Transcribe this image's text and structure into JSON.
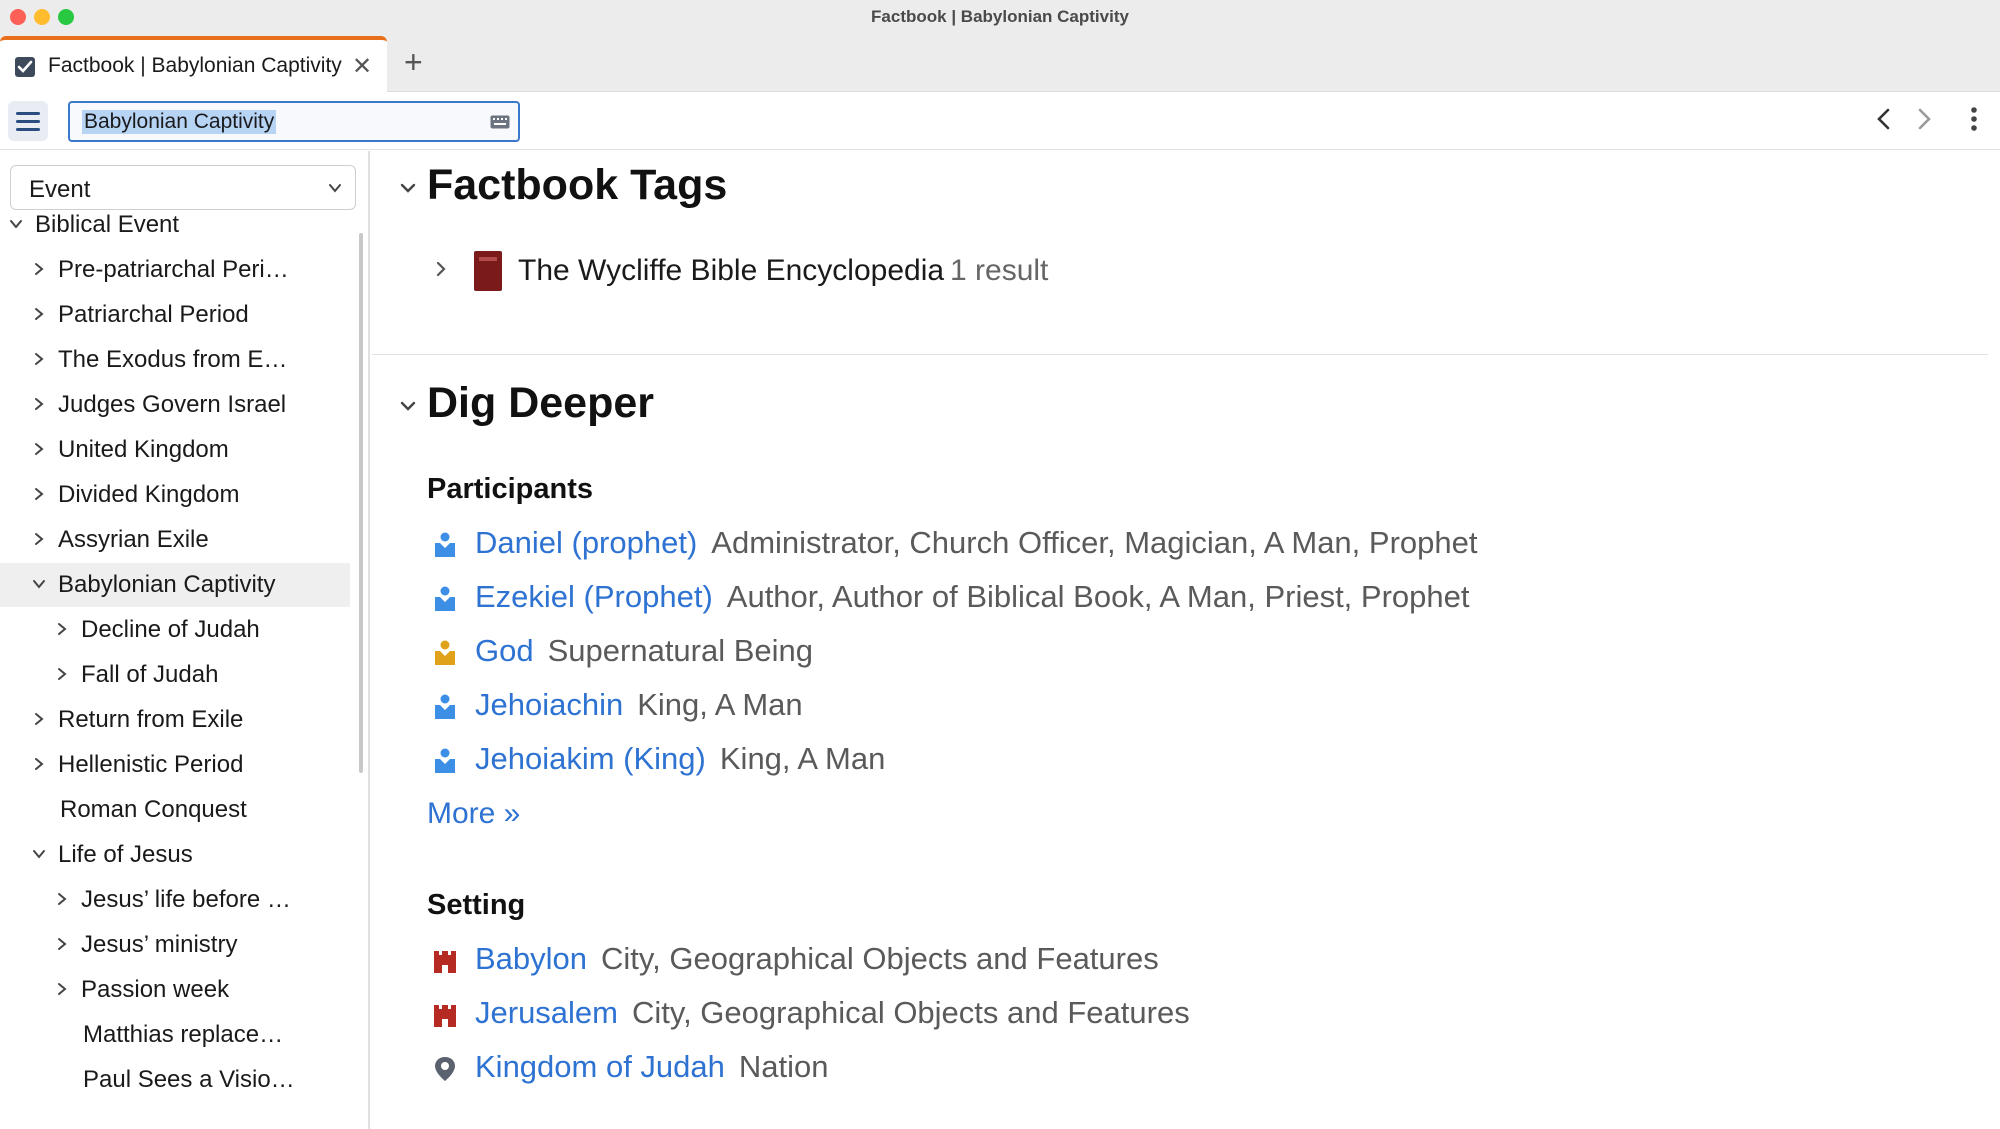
{
  "window": {
    "title": "Factbook | Babylonian Captivity"
  },
  "tabs": [
    {
      "label": "Factbook | Babylonian Captivity"
    }
  ],
  "toolbar": {
    "search_value": "Babylonian Captivity"
  },
  "sidebar": {
    "type_select": "Event",
    "items": [
      {
        "label": "Biblical Event",
        "state": "expanded"
      },
      {
        "label": "Pre-patriarchal Peri…",
        "state": "collapsed"
      },
      {
        "label": "Patriarchal Period",
        "state": "collapsed"
      },
      {
        "label": "The Exodus from E…",
        "state": "collapsed"
      },
      {
        "label": "Judges Govern Israel",
        "state": "collapsed"
      },
      {
        "label": "United Kingdom",
        "state": "collapsed"
      },
      {
        "label": "Divided Kingdom",
        "state": "collapsed"
      },
      {
        "label": "Assyrian Exile",
        "state": "collapsed"
      },
      {
        "label": "Babylonian Captivity",
        "state": "expanded",
        "selected": true
      },
      {
        "label": "Decline of Judah",
        "state": "collapsed"
      },
      {
        "label": "Fall of Judah",
        "state": "collapsed"
      },
      {
        "label": "Return from Exile",
        "state": "collapsed"
      },
      {
        "label": "Hellenistic Period",
        "state": "collapsed"
      },
      {
        "label": "Roman Conquest",
        "state": "leaf"
      },
      {
        "label": "Life of Jesus",
        "state": "expanded"
      },
      {
        "label": "Jesus’ life before …",
        "state": "collapsed"
      },
      {
        "label": "Jesus’ ministry",
        "state": "collapsed"
      },
      {
        "label": "Passion week",
        "state": "collapsed"
      },
      {
        "label": "Matthias replace…",
        "state": "leaf"
      },
      {
        "label": "Paul Sees a Visio…",
        "state": "leaf"
      }
    ]
  },
  "main": {
    "factbook_tags": {
      "title": "Factbook Tags",
      "resource": {
        "title": "The Wycliffe Bible Encyclopedia",
        "count": "1 result"
      }
    },
    "dig_deeper": {
      "title": "Dig Deeper",
      "participants_heading": "Participants",
      "participants": [
        {
          "name": "Daniel (prophet)",
          "desc": "Administrator, Church Officer, Magician, A Man, Prophet",
          "icon": "person-icon",
          "color": "#3d8fe6"
        },
        {
          "name": "Ezekiel (Prophet)",
          "desc": "Author, Author of Biblical Book, A Man, Priest, Prophet",
          "icon": "person-icon",
          "color": "#3d8fe6"
        },
        {
          "name": "God",
          "desc": "Supernatural Being",
          "icon": "deity-icon",
          "color": "#e0a21a"
        },
        {
          "name": "Jehoiachin",
          "desc": "King, A Man",
          "icon": "person-icon",
          "color": "#3d8fe6"
        },
        {
          "name": "Jehoiakim (King)",
          "desc": "King, A Man",
          "icon": "person-icon",
          "color": "#3d8fe6"
        }
      ],
      "more_label": "More »",
      "setting_heading": "Setting",
      "settings": [
        {
          "name": "Babylon",
          "desc": "City, Geographical Objects and Features",
          "icon": "castle-icon",
          "color": "#b52a22"
        },
        {
          "name": "Jerusalem",
          "desc": "City, Geographical Objects and Features",
          "icon": "castle-icon",
          "color": "#b52a22"
        },
        {
          "name": "Kingdom of Judah",
          "desc": "Nation",
          "icon": "map-pin-icon",
          "color": "#5a6270"
        }
      ]
    }
  }
}
